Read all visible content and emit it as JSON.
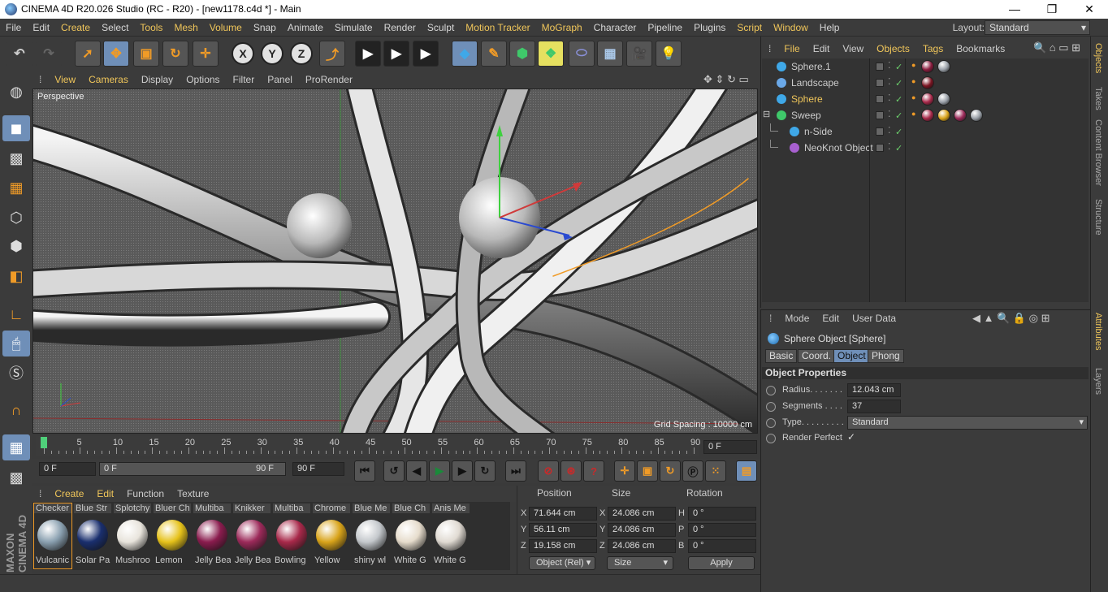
{
  "window": {
    "title": "CINEMA 4D R20.026 Studio (RC - R20) - [new1178.c4d *] - Main",
    "min": "—",
    "max": "❐",
    "close": "✕"
  },
  "menubar": {
    "items": [
      "File",
      "Edit",
      "Create",
      "Select",
      "Tools",
      "Mesh",
      "Volume",
      "Snap",
      "Animate",
      "Simulate",
      "Render",
      "Sculpt",
      "Motion Tracker",
      "MoGraph",
      "Character",
      "Pipeline",
      "Plugins",
      "Script",
      "Window",
      "Help"
    ],
    "highlighted": [
      "Create",
      "Tools",
      "Mesh",
      "Volume",
      "Motion Tracker",
      "MoGraph",
      "Script",
      "Window"
    ],
    "layout_label": "Layout:",
    "layout_value": "Standard"
  },
  "toolbar": {
    "x": "X",
    "y": "Y",
    "z": "Z"
  },
  "viewport": {
    "menu": [
      "View",
      "Cameras",
      "Display",
      "Options",
      "Filter",
      "Panel",
      "ProRender"
    ],
    "highlighted": [
      "View",
      "Cameras"
    ],
    "label": "Perspective",
    "grid": "Grid Spacing : 10000 cm"
  },
  "timeline": {
    "ticks": [
      0,
      5,
      10,
      15,
      20,
      25,
      30,
      35,
      40,
      45,
      50,
      55,
      60,
      65,
      70,
      75,
      80,
      85,
      90
    ],
    "current_field": "0 F",
    "start": "0 F",
    "range_start": "0 F",
    "range_end": "90 F",
    "end": "90 F"
  },
  "materials": {
    "menu": [
      "Create",
      "Edit",
      "Function",
      "Texture"
    ],
    "highlighted": [
      "Create",
      "Edit"
    ],
    "items": [
      {
        "top": "Checker",
        "bottom": "Vulcanic",
        "color": "#8aa0b0"
      },
      {
        "top": "Blue Str",
        "bottom": "Solar Pa",
        "color": "#1a2f6e"
      },
      {
        "top": "Splotchy",
        "bottom": "Mushroo",
        "color": "#e8e4dc"
      },
      {
        "top": "Bluer Ch",
        "bottom": "Lemon",
        "color": "#e6c21a"
      },
      {
        "top": "Multiba",
        "bottom": "Jelly Bea",
        "color": "#8a1c4e"
      },
      {
        "top": "Knikker",
        "bottom": "Jelly Bea",
        "color": "#9c2a5a"
      },
      {
        "top": "Multiba",
        "bottom": "Bowling",
        "color": "#a8294a"
      },
      {
        "top": "Chrome",
        "bottom": "Yellow",
        "color": "#d9a41a"
      },
      {
        "top": "Blue Me",
        "bottom": "shiny wl",
        "color": "#c4c8cc"
      },
      {
        "top": "Blue Ch",
        "bottom": "White G",
        "color": "#e6dccc"
      },
      {
        "top": "Anis Me",
        "bottom": "White G",
        "color": "#e0dad2"
      }
    ]
  },
  "coords": {
    "headers": [
      "Position",
      "Size",
      "Rotation"
    ],
    "rows": [
      {
        "axis": "X",
        "pos": "71.644 cm",
        "saxis": "X",
        "size": "24.086 cm",
        "raxis": "H",
        "rot": "0 °"
      },
      {
        "axis": "Y",
        "pos": "56.11 cm",
        "saxis": "Y",
        "size": "24.086 cm",
        "raxis": "P",
        "rot": "0 °"
      },
      {
        "axis": "Z",
        "pos": "19.158 cm",
        "saxis": "Z",
        "size": "24.086 cm",
        "raxis": "B",
        "rot": "0 °"
      }
    ],
    "mode": "Object (Rel)",
    "size_mode": "Size",
    "apply": "Apply"
  },
  "objects": {
    "menu": [
      "File",
      "Edit",
      "View",
      "Objects",
      "Tags",
      "Bookmarks"
    ],
    "highlighted": [
      "File",
      "Objects",
      "Tags"
    ],
    "rows": [
      {
        "name": "Sphere.1",
        "indent": 0,
        "icon": "#3fa8e8",
        "hl": false
      },
      {
        "name": "Landscape",
        "indent": 0,
        "icon": "#6aa8e8",
        "hl": false
      },
      {
        "name": "Sphere",
        "indent": 0,
        "icon": "#3fa8e8",
        "hl": true
      },
      {
        "name": "Sweep",
        "indent": 0,
        "icon": "#3fc86a",
        "hl": false
      },
      {
        "name": "n-Side",
        "indent": 1,
        "icon": "#3fa8e8",
        "hl": false
      },
      {
        "name": "NeoKnot Object",
        "indent": 1,
        "icon": "#a860d0",
        "hl": false
      }
    ]
  },
  "attributes": {
    "menu": [
      "Mode",
      "Edit",
      "User Data"
    ],
    "object": "Sphere Object [Sphere]",
    "tabs": [
      "Basic",
      "Coord.",
      "Object",
      "Phong"
    ],
    "active_tab": "Object",
    "section": "Object Properties",
    "radius_label": "Radius. . . . . . .",
    "radius": "12.043 cm",
    "segments_label": "Segments . . . .",
    "segments": "37",
    "type_label": "Type. . . . . . . . .",
    "type": "Standard",
    "render_perfect_label": "Render Perfect",
    "render_perfect": "✓"
  },
  "right_tabs": [
    "Objects",
    "Takes",
    "Content Browser",
    "Structure",
    "Attributes",
    "Layers"
  ],
  "branding": "MAXON CINEMA 4D"
}
